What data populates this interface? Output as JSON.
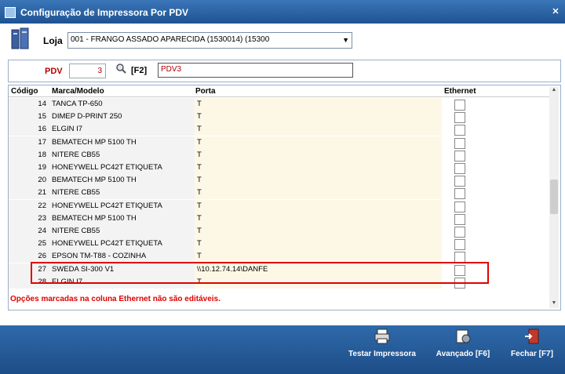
{
  "window": {
    "title": "Configuração de Impressora Por PDV"
  },
  "loja": {
    "label": "Loja",
    "value": "001 - FRANGO ASSADO APARECIDA (1530014) (15300"
  },
  "pdv": {
    "label": "PDV",
    "value": "3",
    "f2_label": "[F2]",
    "name": "PDV3"
  },
  "grid": {
    "headers": {
      "code": "Código",
      "model": "Marca/Modelo",
      "port": "Porta",
      "ethernet": "Ethernet"
    },
    "rows": [
      {
        "code": "14",
        "model": "TANCA TP-650",
        "port": "T",
        "ethernet": false
      },
      {
        "code": "15",
        "model": "DIMEP D-PRINT 250",
        "port": "T",
        "ethernet": false
      },
      {
        "code": "16",
        "model": "ELGIN I7",
        "port": "T",
        "ethernet": false
      },
      {
        "code": "17",
        "model": "BEMATECH MP 5100 TH",
        "port": "T",
        "ethernet": false
      },
      {
        "code": "18",
        "model": "NITERE CB55",
        "port": "T",
        "ethernet": false
      },
      {
        "code": "19",
        "model": "HONEYWELL PC42T ETIQUETA",
        "port": "T",
        "ethernet": false
      },
      {
        "code": "20",
        "model": "BEMATECH MP 5100 TH",
        "port": "T",
        "ethernet": false
      },
      {
        "code": "21",
        "model": "NITERE CB55",
        "port": "T",
        "ethernet": false
      },
      {
        "code": "22",
        "model": "HONEYWELL PC42T ETIQUETA",
        "port": "T",
        "ethernet": false
      },
      {
        "code": "23",
        "model": "BEMATECH MP 5100 TH",
        "port": "T",
        "ethernet": false
      },
      {
        "code": "24",
        "model": "NITERE CB55",
        "port": "T",
        "ethernet": false
      },
      {
        "code": "25",
        "model": "HONEYWELL PC42T ETIQUETA",
        "port": "T",
        "ethernet": false
      },
      {
        "code": "26",
        "model": "EPSON TM-T88 - COZINHA",
        "port": "T",
        "ethernet": false
      },
      {
        "code": "27",
        "model": "SWEDA SI-300 V1",
        "port": "\\\\10.12.74.14\\DANFE",
        "ethernet": false
      },
      {
        "code": "28",
        "model": "ELGIN I7",
        "port": "T",
        "ethernet": false
      }
    ]
  },
  "warning": "Opções marcadas na coluna Ethernet não são editáveis.",
  "footer": {
    "test_label": "Testar Impressora",
    "advanced_label": "Avançado [F6]",
    "close_label": "Fechar [F7]"
  },
  "colors": {
    "accent": "#2a5d9c",
    "warning": "#e00000",
    "pdv_text": "#b30000"
  }
}
